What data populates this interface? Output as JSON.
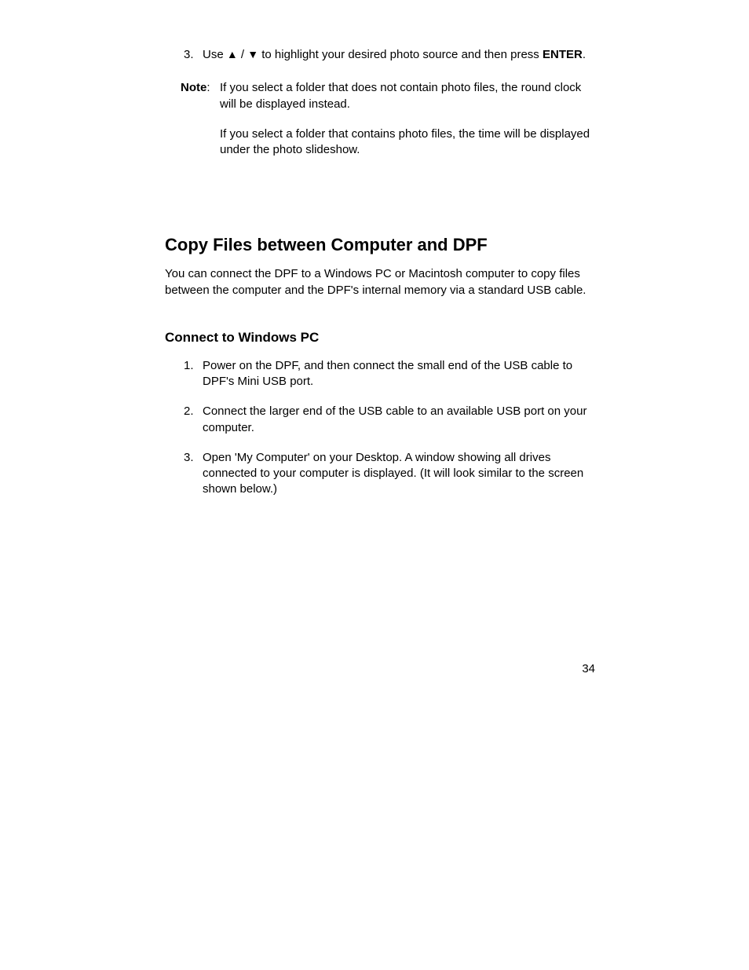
{
  "topStep": {
    "number": "3.",
    "text_part1": "Use ",
    "arrow_up": "▲",
    "slash": " / ",
    "arrow_down": "▼",
    "text_part2": " to highlight your desired photo source and then press ",
    "enter": "ENTER",
    "period": "."
  },
  "note": {
    "label": "Note",
    "colon": ":",
    "para1": "If you select a folder that does not contain photo files, the round clock will be displayed instead.",
    "para2": "If you select a folder that contains photo files, the time will be displayed under the photo slideshow."
  },
  "section": {
    "heading": "Copy Files between Computer and DPF",
    "intro": "You can connect the DPF to a Windows PC or Macintosh computer to copy files between the computer and the DPF's internal memory via a standard USB cable."
  },
  "subsection": {
    "heading": "Connect to Windows PC",
    "items": [
      {
        "number": "1.",
        "text": "Power on the DPF, and then connect the small end of the USB cable to DPF's Mini USB port."
      },
      {
        "number": "2.",
        "text": "Connect the larger end of the USB cable to an available USB port on your computer."
      },
      {
        "number": "3.",
        "text": "Open 'My Computer' on your Desktop. A window showing all drives connected to your computer is displayed. (It will look similar to the screen shown below.)"
      }
    ]
  },
  "pageNumber": "34"
}
